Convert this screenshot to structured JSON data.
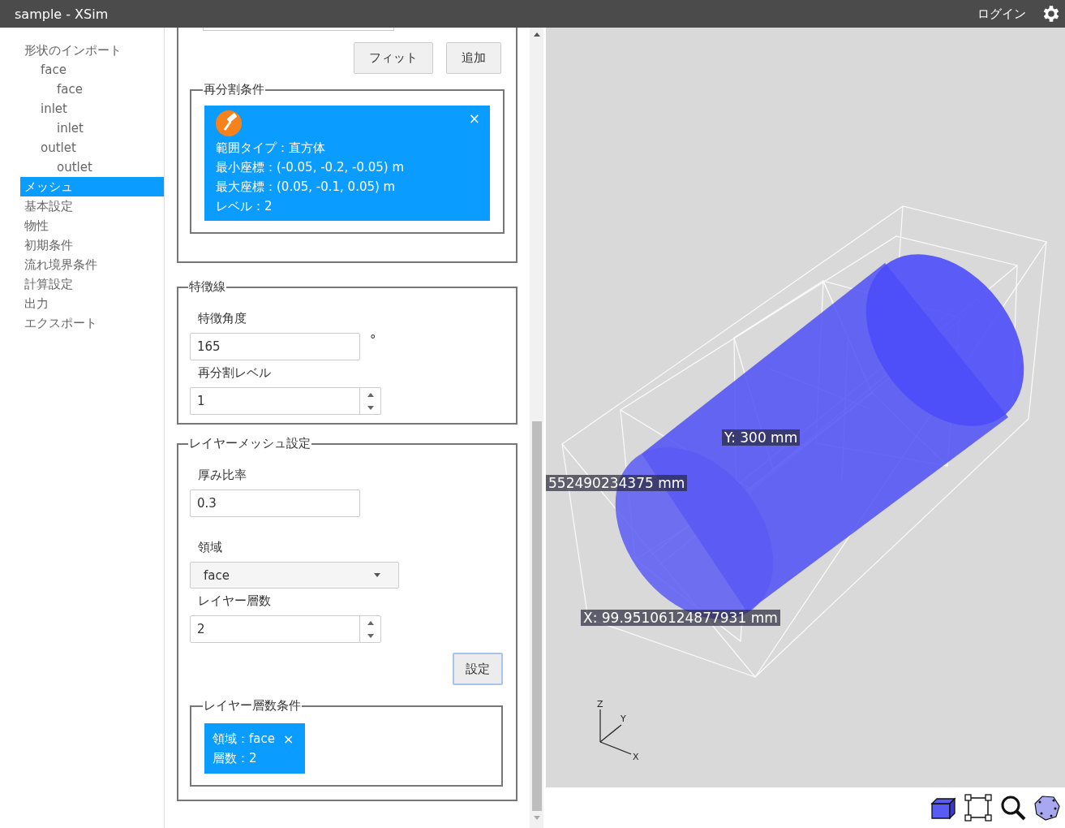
{
  "window": {
    "title": "sample - XSim"
  },
  "header": {
    "login": "ログイン"
  },
  "sidebar": {
    "items": [
      {
        "label": "形状のインポート",
        "selected": false,
        "children": [
          {
            "label": "face",
            "selected": false,
            "children": [
              {
                "label": "face",
                "selected": false
              }
            ]
          },
          {
            "label": "inlet",
            "selected": false,
            "children": [
              {
                "label": "inlet",
                "selected": false
              }
            ]
          },
          {
            "label": "outlet",
            "selected": false,
            "children": [
              {
                "label": "outlet",
                "selected": false
              }
            ]
          }
        ]
      },
      {
        "label": "メッシュ",
        "selected": true
      },
      {
        "label": "基本設定",
        "selected": false
      },
      {
        "label": "物性",
        "selected": false
      },
      {
        "label": "初期条件",
        "selected": false
      },
      {
        "label": "流れ境界条件",
        "selected": false
      },
      {
        "label": "計算設定",
        "selected": false
      },
      {
        "label": "出力",
        "selected": false
      },
      {
        "label": "エクスポート",
        "selected": false
      }
    ]
  },
  "refinement": {
    "buttons": [
      "フィット",
      "追加"
    ],
    "legend": "再分割条件",
    "conditions": [
      {
        "close": "×",
        "lines": [
          "範囲タイプ：直方体",
          "最小座標：(-0.05, -0.2, -0.05) m",
          "最大座標：(0.05, -0.1, 0.05) m",
          "レベル：2"
        ]
      }
    ]
  },
  "feature_lines": {
    "legend": "特徴線",
    "angle_label": "特徴角度",
    "angle": "165",
    "unit": "°",
    "level_label": "再分割レベル",
    "level": "1"
  },
  "layer_mesh": {
    "legend": "レイヤーメッシュ設定",
    "ratio_label": "厚み比率",
    "ratio": "0.3",
    "region_label": "領域",
    "region": "face",
    "count_label": "レイヤー層数",
    "count": "2",
    "set_button": "設定",
    "conditions_legend": "レイヤー層数条件",
    "conditions": [
      {
        "close": "×",
        "lines": [
          "領域：face",
          "層数：2"
        ]
      }
    ]
  },
  "viewer": {
    "labels": [
      "Y: 300 mm",
      "552490234375 mm",
      "X: 99.95106124877931 mm"
    ],
    "axes": [
      "Z",
      "Y",
      "X"
    ]
  }
}
